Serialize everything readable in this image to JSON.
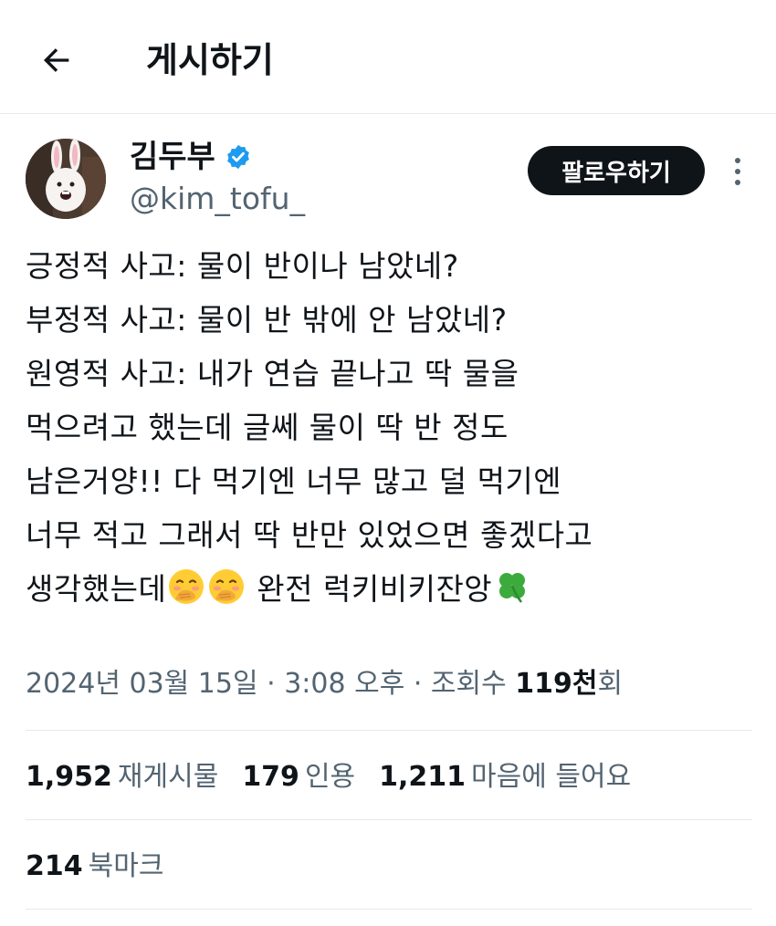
{
  "header": {
    "title": "게시하기"
  },
  "author": {
    "name": "김두부",
    "handle": "@kim_tofu_",
    "follow_label": "팔로우하기"
  },
  "tweet": {
    "lines": [
      "긍정적 사고: 물이 반이나 남았네?",
      "부정적 사고: 물이 반 밖에 안 남았네?",
      "원영적 사고: 내가 연습 끝나고 딱 물을",
      "먹으려고 했는데 글쎄 물이 딱 반 정도",
      "남은거양!! 다 먹기엔 너무 많고 덜 먹기엔",
      "너무 적고 그래서 딱 반만 있었으면 좋겠다고"
    ],
    "last_line_start": "생각했는데",
    "last_line_end": " 완전 럭키비키잔앙"
  },
  "meta": {
    "date": "2024년 03월 15일",
    "sep1": " · ",
    "time": "3:08 오후",
    "sep2": " · ",
    "views_prefix": "조회수 ",
    "views_value": "119천",
    "views_suffix": "회"
  },
  "stats": {
    "retweets": "1,952",
    "retweets_label": "재게시물",
    "quotes": "179",
    "quotes_label": "인용",
    "likes": "1,211",
    "likes_label": "마음에 들어요",
    "bookmarks": "214",
    "bookmarks_label": "북마크"
  },
  "colors": {
    "text": "#0f1419",
    "secondary": "#536471",
    "verified": "#1d9bf0",
    "divider": "#e6e9ec",
    "follow_bg": "#0f1419"
  },
  "icons": {
    "back": "back-arrow-icon",
    "verified": "verified-badge-icon",
    "more": "more-vertical-icon",
    "emoji": "face-with-hand-over-mouth-emoji",
    "clover": "four-leaf-clover-emoji"
  }
}
